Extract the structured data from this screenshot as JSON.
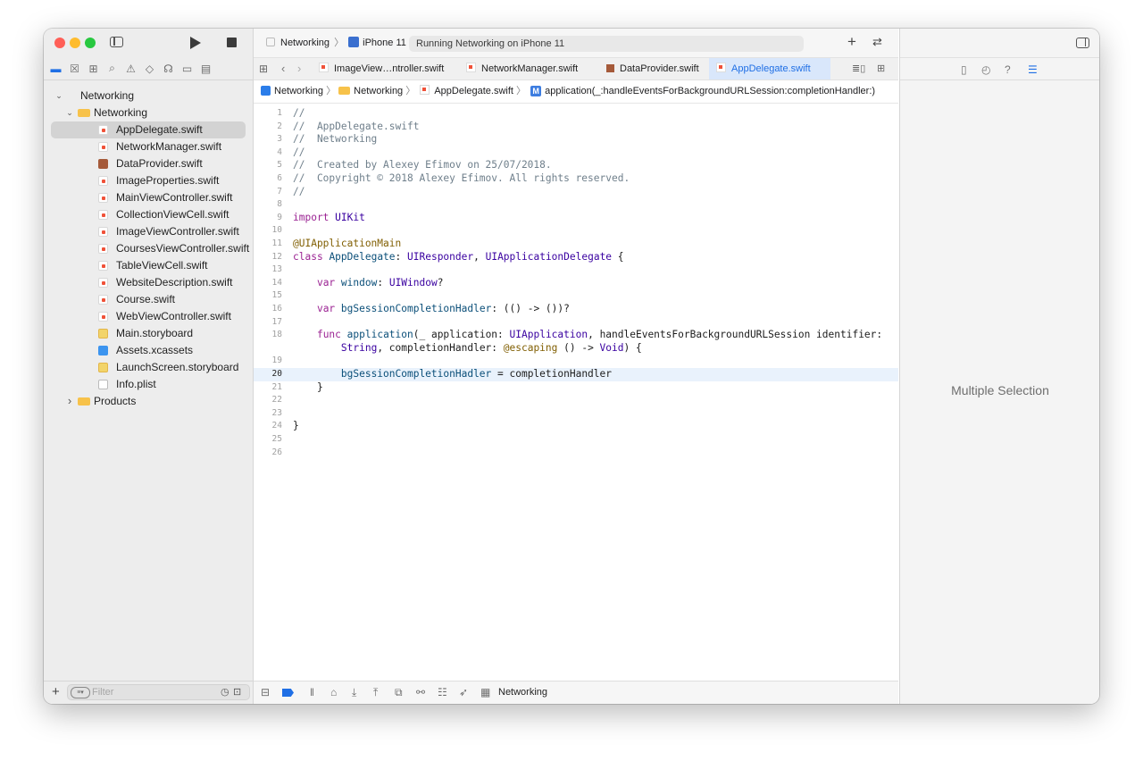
{
  "toolbar": {
    "scheme": "Networking",
    "device": "iPhone 11",
    "activity": "Running Networking on iPhone 11"
  },
  "navigator": {
    "tree": [
      {
        "label": "Networking",
        "type": "project",
        "level": 0,
        "expanded": true
      },
      {
        "label": "Networking",
        "type": "folder",
        "level": 1,
        "expanded": true
      },
      {
        "label": "AppDelegate.swift",
        "type": "swift",
        "level": 2,
        "selected": true
      },
      {
        "label": "NetworkManager.swift",
        "type": "swift",
        "level": 2
      },
      {
        "label": "DataProvider.swift",
        "type": "book",
        "level": 2
      },
      {
        "label": "ImageProperties.swift",
        "type": "swift",
        "level": 2
      },
      {
        "label": "MainViewController.swift",
        "type": "swift",
        "level": 2
      },
      {
        "label": "CollectionViewCell.swift",
        "type": "swift",
        "level": 2
      },
      {
        "label": "ImageViewController.swift",
        "type": "swift",
        "level": 2
      },
      {
        "label": "CoursesViewController.swift",
        "type": "swift",
        "level": 2
      },
      {
        "label": "TableViewCell.swift",
        "type": "swift",
        "level": 2
      },
      {
        "label": "WebsiteDescription.swift",
        "type": "swift",
        "level": 2
      },
      {
        "label": "Course.swift",
        "type": "swift",
        "level": 2
      },
      {
        "label": "WebViewController.swift",
        "type": "swift",
        "level": 2
      },
      {
        "label": "Main.storyboard",
        "type": "story",
        "level": 2
      },
      {
        "label": "Assets.xcassets",
        "type": "assets",
        "level": 2
      },
      {
        "label": "LaunchScreen.storyboard",
        "type": "story",
        "level": 2
      },
      {
        "label": "Info.plist",
        "type": "plist",
        "level": 2
      },
      {
        "label": "Products",
        "type": "folder",
        "level": 1,
        "expanded": false
      }
    ],
    "filter_placeholder": "Filter"
  },
  "tabs": [
    {
      "label": "ImageView…ntroller.swift",
      "active": false
    },
    {
      "label": "NetworkManager.swift",
      "active": false
    },
    {
      "label": "DataProvider.swift",
      "active": false
    },
    {
      "label": "AppDelegate.swift",
      "active": true
    }
  ],
  "jumpbar": {
    "project": "Networking",
    "group": "Networking",
    "file": "AppDelegate.swift",
    "method_badge": "M",
    "symbol": "application(_:handleEventsForBackgroundURLSession:completionHandler:)"
  },
  "editor": {
    "current_line": 20,
    "lines": [
      {
        "n": "1",
        "text": "//"
      },
      {
        "n": "2",
        "text": "//  AppDelegate.swift"
      },
      {
        "n": "3",
        "text": "//  Networking"
      },
      {
        "n": "4",
        "text": "//"
      },
      {
        "n": "5",
        "text": "//  Created by Alexey Efimov on 25/07/2018."
      },
      {
        "n": "6",
        "text": "//  Copyright © 2018 Alexey Efimov. All rights reserved."
      },
      {
        "n": "7",
        "text": "//"
      },
      {
        "n": "8",
        "text": ""
      },
      {
        "n": "9",
        "text": "import UIKit"
      },
      {
        "n": "10",
        "text": ""
      },
      {
        "n": "11",
        "text": "@UIApplicationMain"
      },
      {
        "n": "12",
        "text": "class AppDelegate: UIResponder, UIApplicationDelegate {"
      },
      {
        "n": "13",
        "text": ""
      },
      {
        "n": "14",
        "text": "    var window: UIWindow?"
      },
      {
        "n": "15",
        "text": ""
      },
      {
        "n": "16",
        "text": "    var bgSessionCompletionHadler: (() -> ())?"
      },
      {
        "n": "17",
        "text": ""
      },
      {
        "n": "18",
        "text": "    func application(_ application: UIApplication, handleEventsForBackgroundURLSession identifier:"
      },
      {
        "n": "",
        "text": "        String, completionHandler: @escaping () -> Void) {"
      },
      {
        "n": "19",
        "text": ""
      },
      {
        "n": "20",
        "text": "        bgSessionCompletionHadler = completionHandler"
      },
      {
        "n": "21",
        "text": "    }"
      },
      {
        "n": "22",
        "text": ""
      },
      {
        "n": "23",
        "text": ""
      },
      {
        "n": "24",
        "text": "}"
      },
      {
        "n": "25",
        "text": ""
      },
      {
        "n": "26",
        "text": ""
      }
    ]
  },
  "debug": {
    "target": "Networking"
  },
  "inspector": {
    "placeholder": "Multiple Selection"
  },
  "colors": {
    "accent": "#1f6fe5",
    "close": "#ff5f57",
    "minimize": "#febc2e",
    "zoom": "#28c840"
  }
}
